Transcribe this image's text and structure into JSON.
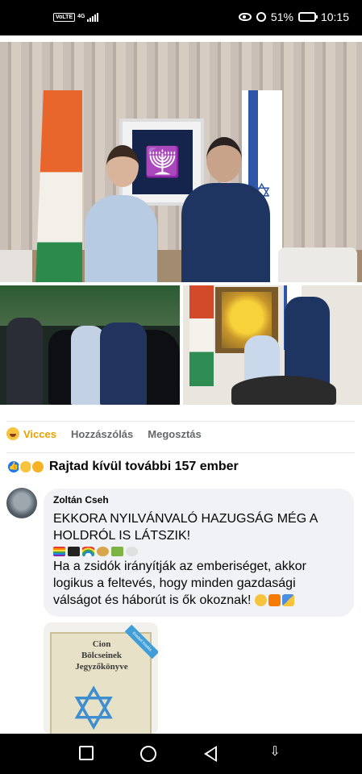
{
  "status_bar": {
    "volte": "VoLTE",
    "network": "4G",
    "battery_percent": "51%",
    "time": "10:15",
    "battery_level": 0.51
  },
  "photos": {
    "main_emblem_glyph": "🕎",
    "book_star_glyph": "✡"
  },
  "actions": {
    "reaction_label": "Vicces",
    "comment_label": "Hozzászólás",
    "share_label": "Megosztás"
  },
  "reactions": {
    "icons": [
      "like-icon",
      "haha-icon",
      "wow-icon"
    ],
    "summary": "Rajtad kívül további 157 ember"
  },
  "comment": {
    "author": "Zoltán Cseh",
    "text_line1": "EKKORA NYILVÁNVALÓ HAZUGSÁG MÉG A HOLDRÓL IS LÁTSZIK!",
    "text_line2": "Ha a zsidók irányítják az emberiséget, akkor logikus a feltevés, hogy minden gazdasági válságot és háborút is ők okoznak!",
    "leading_emojis": [
      "rainbow-flag",
      "pirate-flag",
      "rainbow",
      "money-bag",
      "dollar-banknote",
      "skull-crossbones"
    ],
    "trailing_emojis": [
      "smiling-face",
      "vs-button",
      "performing-arts"
    ]
  },
  "attachment": {
    "book_title_lines": [
      "Cion",
      "Bölcseinek",
      "Jegyzőkönyve"
    ],
    "ribbon_text": "Eredeti kiadás"
  },
  "colors": {
    "accent_blue": "#1877f2",
    "haha_yellow": "#e8a200",
    "bubble_bg": "#f0f2f5"
  }
}
